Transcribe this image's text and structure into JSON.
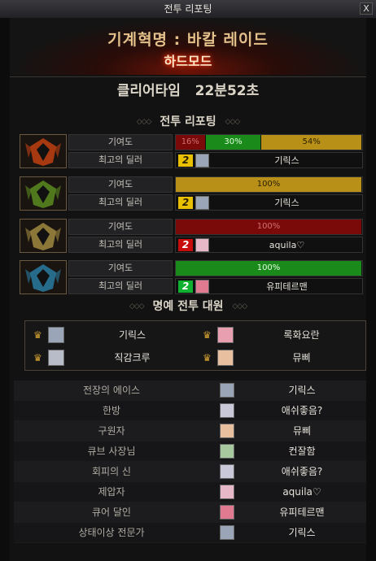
{
  "window": {
    "title": "전투 리포팅",
    "close_label": "X"
  },
  "raid": {
    "name": "기계혁명 : 바칼 레이드",
    "mode": "하드모드"
  },
  "clear": {
    "label": "클리어타임",
    "time": "22분52초"
  },
  "sections": {
    "report": "전투 리포팅",
    "honor": "명예 전투 대원",
    "deco_left": "◇◇◇",
    "deco_right": "◇◇◇"
  },
  "labels": {
    "contribution": "기여도",
    "top_dealer": "최고의 딜러"
  },
  "parties": [
    {
      "portrait": "red-mech-icon",
      "color": "#c04010",
      "segments": [
        {
          "value": "16%",
          "pct": 16,
          "kind": "red"
        },
        {
          "value": "30%",
          "pct": 30,
          "kind": "green"
        },
        {
          "value": "54%",
          "pct": 54,
          "kind": "yellow"
        }
      ],
      "dealer": {
        "rank": "2",
        "rank_color": "y",
        "name": "기릭스",
        "avatar": "#9aa6b8"
      }
    },
    {
      "portrait": "green-mech-icon",
      "color": "#5a8a20",
      "segments": [
        {
          "value": "100%",
          "pct": 100,
          "kind": "yellow"
        }
      ],
      "dealer": {
        "rank": "2",
        "rank_color": "y",
        "name": "기릭스",
        "avatar": "#9aa6b8"
      }
    },
    {
      "portrait": "gold-mech-icon",
      "color": "#a08840",
      "segments": [
        {
          "value": "100%",
          "pct": 100,
          "kind": "red"
        }
      ],
      "dealer": {
        "rank": "2",
        "rank_color": "r",
        "name": "aquila♡",
        "avatar": "#e6b8c8"
      }
    },
    {
      "portrait": "blue-mech-icon",
      "color": "#2a7aa0",
      "segments": [
        {
          "value": "100%",
          "pct": 100,
          "kind": "green"
        }
      ],
      "dealer": {
        "rank": "2",
        "rank_color": "g",
        "name": "유피테르맨",
        "avatar": "#e07a90"
      }
    }
  ],
  "honor": [
    {
      "name": "기릭스",
      "avatar": "#9aa6b8"
    },
    {
      "name": "록화요란",
      "avatar": "#e8a0b0"
    },
    {
      "name": "직감크루",
      "avatar": "#b8bcc8"
    },
    {
      "name": "뮤삐",
      "avatar": "#e8c0a0"
    }
  ],
  "titles": [
    {
      "title": "전장의 에이스",
      "name": "기릭스",
      "avatar": "#9aa6b8"
    },
    {
      "title": "한방",
      "name": "애쉬좋음?",
      "avatar": "#c8c8d8"
    },
    {
      "title": "구원자",
      "name": "뮤삐",
      "avatar": "#e8c0a0"
    },
    {
      "title": "큐브 사장님",
      "name": "컨잘함",
      "avatar": "#a8c8a0"
    },
    {
      "title": "회피의 신",
      "name": "애쉬좋음?",
      "avatar": "#c8c8d8"
    },
    {
      "title": "제압자",
      "name": "aquila♡",
      "avatar": "#e6b8c8"
    },
    {
      "title": "큐어 달인",
      "name": "유피테르맨",
      "avatar": "#e07a90"
    },
    {
      "title": "상태이상 전문가",
      "name": "기릭스",
      "avatar": "#9aa6b8"
    }
  ]
}
